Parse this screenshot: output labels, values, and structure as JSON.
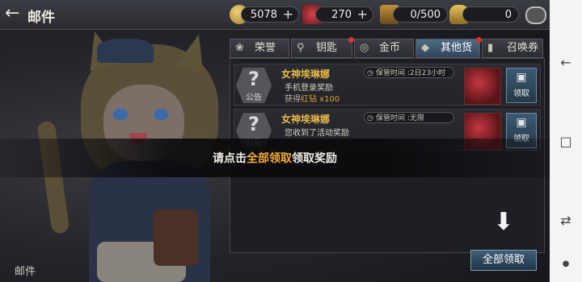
{
  "header": {
    "back_icon": "arrow-left-icon",
    "title": "邮件"
  },
  "resources": [
    {
      "icon": "gold-coin-icon",
      "value": "5078",
      "plus": "+"
    },
    {
      "icon": "red-gem-icon",
      "value": "270",
      "plus": "+"
    },
    {
      "icon": "treasure-chest-icon",
      "value": "0/500"
    },
    {
      "icon": "helmet-icon",
      "value": "0"
    }
  ],
  "tabs": [
    {
      "icon": "honor-icon",
      "label": "荣誉"
    },
    {
      "icon": "key-icon",
      "label": "钥匙"
    },
    {
      "icon": "coin-icon",
      "label": "金币"
    },
    {
      "icon": "currency-icon",
      "label": "其他货币",
      "active": true
    },
    {
      "icon": "card-icon",
      "label": "召唤券"
    }
  ],
  "mails": [
    {
      "badge_symbol": "?",
      "category": "公告",
      "sender": "女神埃琳娜",
      "subject": "手机登录奖励",
      "detail_prefix": "获得",
      "detail_highlight": "红钻",
      "detail_suffix": " x100",
      "keep_label": "保管时间 :2日23小时",
      "claim_label": "领取"
    },
    {
      "badge_symbol": "?",
      "category": "公告",
      "sender": "女神埃琳娜",
      "subject": "您收到了活动奖励",
      "keep_label": "保管时间 :无限",
      "claim_label": "领取"
    }
  ],
  "toast": {
    "prefix": "请点击",
    "highlight": "全部领取",
    "suffix": "领取奖励"
  },
  "claim_all_label": "全部领取",
  "bottom_left_label": "邮件",
  "colors": {
    "accent_gold": "#f2a93b",
    "sender_gold": "#e9b94a",
    "button_blue": "#304458"
  }
}
